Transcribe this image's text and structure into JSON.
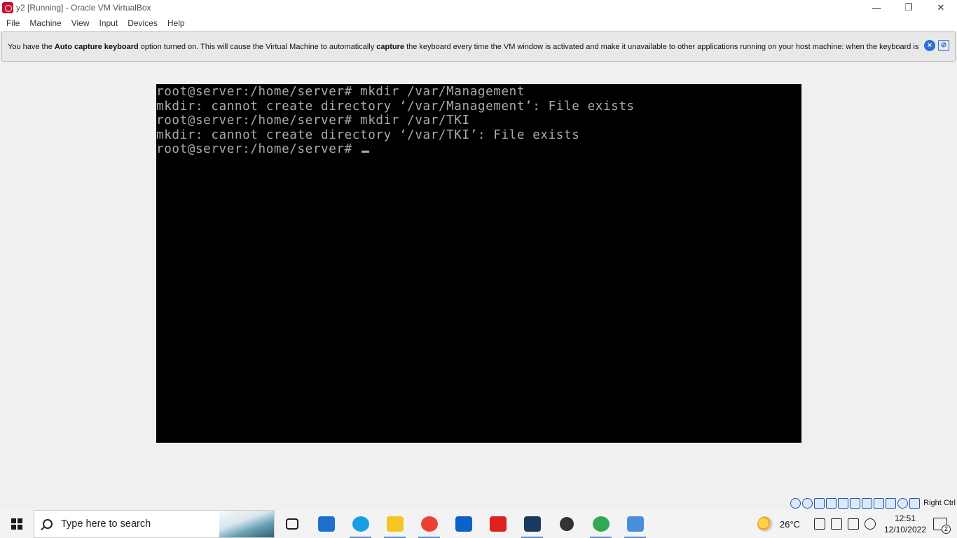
{
  "window": {
    "title": "y2 [Running] - Oracle VM VirtualBox",
    "controls": [
      "minimize-icon",
      "restore-icon",
      "close-icon"
    ]
  },
  "menu": {
    "items": [
      "File",
      "Machine",
      "View",
      "Input",
      "Devices",
      "Help"
    ]
  },
  "notice": {
    "part1": "You have the ",
    "bold1": "Auto capture keyboard",
    "part2": " option turned on. This will cause the Virtual Machine to automatically ",
    "bold2": "capture",
    "part3": " the keyboard every time the VM window is activated and make it unavailable to other applications running on your host machine: when the keyboard is"
  },
  "console": {
    "lines": [
      "root@server:/home/server# mkdir /var/Management",
      "mkdir: cannot create directory ‘/var/Management’: File exists",
      "root@server:/home/server# mkdir /var/TKI",
      "mkdir: cannot create directory ‘/var/TKI’: File exists",
      "root@server:/home/server# "
    ]
  },
  "status": {
    "host_key": "Right Ctrl"
  },
  "taskbar": {
    "search_placeholder": "Type here to search",
    "weather_temp": "26°C",
    "time": "12:51",
    "date": "12/10/2022",
    "notification_count": "2",
    "apps": [
      {
        "name": "task-view-icon",
        "color": "#222222"
      },
      {
        "name": "mail-icon",
        "color": "#1f6fd1"
      },
      {
        "name": "edge-icon",
        "color": "#1b9de2"
      },
      {
        "name": "file-explorer-icon",
        "color": "#f3c623"
      },
      {
        "name": "chrome-icon",
        "color": "#e94235"
      },
      {
        "name": "store-icon",
        "color": "#0b63c9"
      },
      {
        "name": "wps-icon",
        "color": "#e0201c"
      },
      {
        "name": "virtualbox-icon",
        "color": "#183a61"
      },
      {
        "name": "settings-icon",
        "color": "#333333"
      },
      {
        "name": "chrome-profile-icon",
        "color": "#34a853"
      },
      {
        "name": "remote-desktop-icon",
        "color": "#4a90d9"
      }
    ]
  }
}
